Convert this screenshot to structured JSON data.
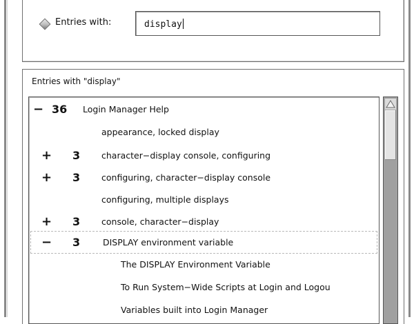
{
  "search": {
    "radio_label": "Entries with:",
    "input_value": "display"
  },
  "results": {
    "heading": "Entries with \"display\"",
    "rows": [
      {
        "sign": "−",
        "count": "36",
        "text": "Login Manager Help"
      },
      {
        "sign": "",
        "count": "",
        "text": "appearance, locked display"
      },
      {
        "sign": "+",
        "count": "3",
        "text": "character−display console, configuring"
      },
      {
        "sign": "+",
        "count": "3",
        "text": "configuring, character−display console"
      },
      {
        "sign": "",
        "count": "",
        "text": "configuring, multiple displays"
      },
      {
        "sign": "+",
        "count": "3",
        "text": "console, character−display"
      },
      {
        "sign": "−",
        "count": "3",
        "text": "DISPLAY environment variable"
      },
      {
        "sign": "",
        "count": "",
        "text": "The DISPLAY Environment Variable"
      },
      {
        "sign": "",
        "count": "",
        "text": "To Run System−Wide Scripts at Login and Logou"
      },
      {
        "sign": "",
        "count": "",
        "text": "Variables built into Login Manager"
      }
    ]
  },
  "icons": {
    "radio": "radio-diamond-icon",
    "scroll_up": "arrow-up-icon"
  }
}
